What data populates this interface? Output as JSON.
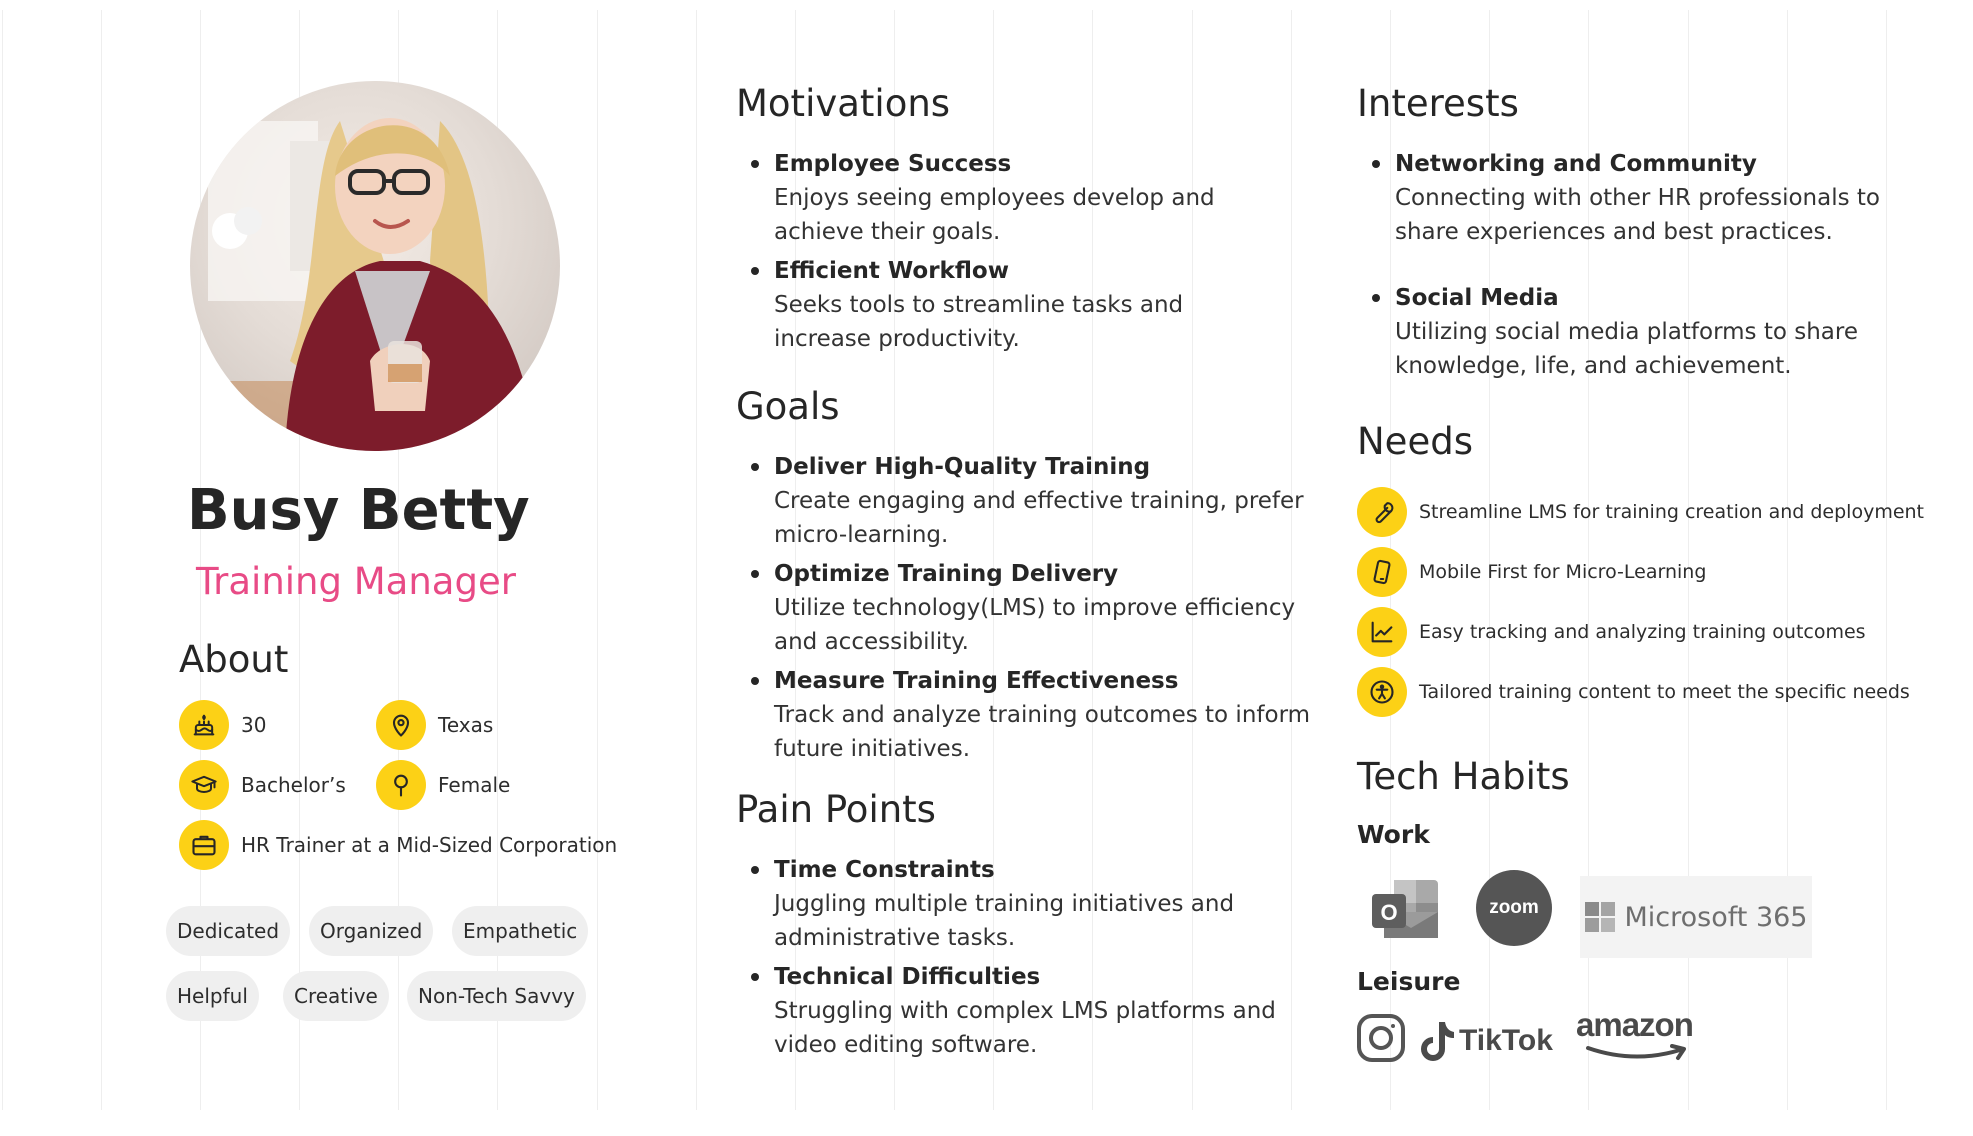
{
  "persona": {
    "name": "Busy Betty",
    "role": "Training Manager"
  },
  "about": {
    "title": "About",
    "age": "30",
    "location": "Texas",
    "education": "Bachelor’s",
    "gender": "Female",
    "occupation": "HR Trainer at a Mid-Sized Corporation",
    "icons": [
      "cake-icon",
      "location-pin-icon",
      "graduation-cap-icon",
      "female-icon",
      "briefcase-icon"
    ],
    "traits": [
      "Dedicated",
      "Organized",
      "Empathetic",
      "Helpful",
      "Creative",
      "Non-Tech Savvy"
    ]
  },
  "motivations": {
    "title": "Motivations",
    "items": [
      {
        "title": "Employee Success",
        "line1": "Enjoys seeing employees develop and",
        "line2": "achieve their goals."
      },
      {
        "title": "Efficient Workflow",
        "line1": "Seeks tools to streamline tasks and",
        "line2": "increase productivity."
      }
    ]
  },
  "goals": {
    "title": "Goals",
    "items": [
      {
        "title": "Deliver High-Quality Training",
        "line1": "Create engaging and effective training, prefer",
        "line2": "micro-learning."
      },
      {
        "title": "Optimize Training Delivery",
        "line1": "Utilize technology(LMS) to improve efficiency",
        "line2": "and accessibility."
      },
      {
        "title": "Measure Training Effectiveness",
        "line1": "Track and analyze training outcomes to inform",
        "line2": "future initiatives."
      }
    ]
  },
  "pain_points": {
    "title": "Pain Points",
    "items": [
      {
        "title": "Time Constraints",
        "line1": "Juggling multiple training initiatives and",
        "line2": "administrative tasks."
      },
      {
        "title": "Technical Difficulties",
        "line1": "Struggling with complex LMS platforms and",
        "line2": "video editing software."
      }
    ]
  },
  "interests": {
    "title": "Interests",
    "items": [
      {
        "title": "Networking and Community",
        "line1": "Connecting with other HR professionals to",
        "line2": "share experiences and best practices."
      },
      {
        "title": "Social Media",
        "line1": "Utilizing social media platforms to share",
        "line2": "knowledge, life, and achievement."
      }
    ]
  },
  "needs": {
    "title": "Needs",
    "items": [
      {
        "icon": "wrench-icon",
        "text": "Streamline LMS for training creation and deployment"
      },
      {
        "icon": "mobile-phone-icon",
        "text": "Mobile First for Micro-Learning"
      },
      {
        "icon": "chart-line-icon",
        "text": "Easy tracking and analyzing training outcomes"
      },
      {
        "icon": "accessibility-icon",
        "text": "Tailored training content to meet the specific needs"
      }
    ]
  },
  "tech_habits": {
    "title": "Tech Habits",
    "work_label": "Work",
    "leisure_label": "Leisure",
    "work_apps": {
      "outlook_letter": "O",
      "zoom": "zoom",
      "microsoft": "Microsoft 365"
    },
    "leisure_apps": {
      "tiktok": "TikTok",
      "amazon": "amazon"
    },
    "icons": [
      "outlook-icon",
      "zoom-icon",
      "microsoft-365-icon",
      "instagram-icon",
      "tiktok-icon",
      "amazon-icon"
    ]
  },
  "colors": {
    "accent_yellow": "#fcd116",
    "role_pink": "#e84b86",
    "chip_bg": "#efefef",
    "text": "#262626"
  }
}
